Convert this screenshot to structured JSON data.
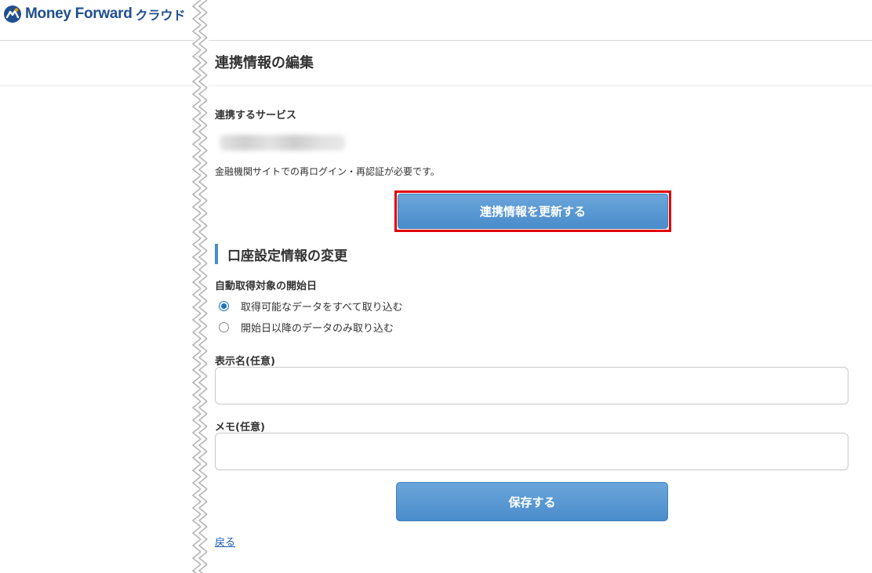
{
  "header": {
    "logo_text": "Money Forward",
    "logo_sub": "クラウド"
  },
  "page": {
    "title": "連携情報の編集"
  },
  "service": {
    "label": "連携するサービス",
    "note": "金融機関サイトでの再ログイン・再認証が必要です。",
    "update_button": "連携情報を更新する"
  },
  "account_settings": {
    "heading": "口座設定情報の変更",
    "start_date_label": "自動取得対象の開始日",
    "options": [
      {
        "label": "取得可能なデータをすべて取り込む",
        "checked": true
      },
      {
        "label": "開始日以降のデータのみ取り込む",
        "checked": false
      }
    ],
    "display_name_label": "表示名(任意)",
    "display_name_value": "",
    "memo_label": "メモ(任意)",
    "memo_value": "",
    "save_button": "保存する"
  },
  "back_link": "戻る",
  "colors": {
    "brand": "#1f4f8f",
    "button": "#4a8ccb",
    "highlight": "#e00000",
    "link": "#1a5cb8"
  }
}
